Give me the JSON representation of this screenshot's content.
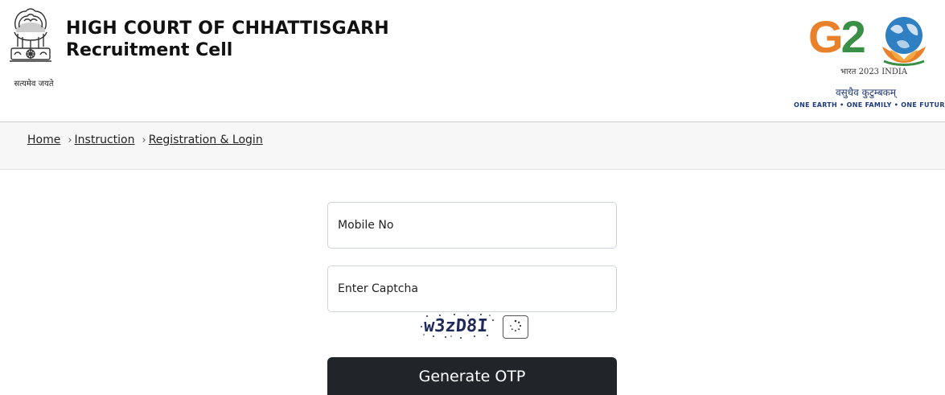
{
  "header": {
    "emblem_caption": "सत्यमेव जयते",
    "court_name": "HIGH COURT OF CHHATTISGARH",
    "cell_name": "Recruitment Cell",
    "g20": {
      "logo_text": "G20",
      "bharat_line": "भारत 2023 INDIA",
      "motto": "वसुधैव कुटुम्बकम्",
      "tagline": "ONE EARTH • ONE FAMILY • ONE FUTURE"
    }
  },
  "breadcrumb": {
    "items": [
      {
        "label": "Home"
      },
      {
        "label": "Instruction"
      },
      {
        "label": "Registration & Login"
      }
    ]
  },
  "form": {
    "mobile_placeholder": "Mobile No",
    "captcha_placeholder": "Enter Captcha",
    "captcha_code": "w3zD8I",
    "submit_label": "Generate OTP"
  },
  "colors": {
    "button_bg": "#212529",
    "g20_orange": "#e8812a",
    "g20_green": "#3a8f46",
    "g20_blue": "#1d3a7a"
  },
  "icons": {
    "emblem": "national-emblem-icon",
    "refresh": "refresh-spinner-icon"
  }
}
